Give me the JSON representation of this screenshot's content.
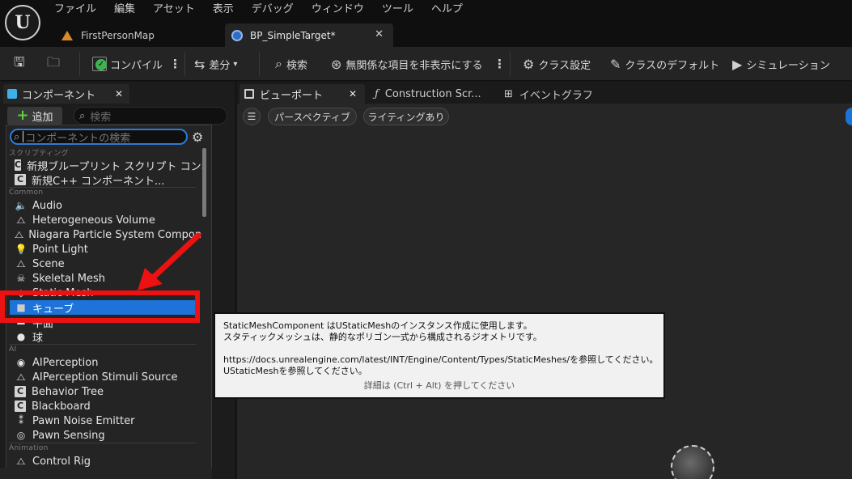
{
  "menu": [
    "ファイル",
    "編集",
    "アセット",
    "表示",
    "デバッグ",
    "ウィンドウ",
    "ツール",
    "ヘルプ"
  ],
  "doc_tabs": {
    "map": "FirstPersonMap",
    "blueprint": "BP_SimpleTarget*"
  },
  "toolbar": {
    "compile": "コンパイル",
    "diff": "差分",
    "search": "検索",
    "hide_unrelated": "無関係な項目を非表示にする",
    "class_settings": "クラス設定",
    "class_defaults": "クラスのデフォルト",
    "simulation": "シミュレーション"
  },
  "components_panel": {
    "tab_label": "コンポーネント",
    "add_label": "追加",
    "search_placeholder": "検索"
  },
  "dropdown": {
    "search_placeholder": "コンポーネントの検索",
    "categories": {
      "scripting": "スクリプティング",
      "common": "Common",
      "ai": "AI",
      "animation": "Animation"
    },
    "items": {
      "new_blueprint": "新規ブループリント スクリプト コンポーネント",
      "new_cpp": "新規C++ コンポーネント...",
      "audio": "Audio",
      "hetero_volume": "Heterogeneous Volume",
      "niagara": "Niagara Particle System Component",
      "point_light": "Point Light",
      "scene": "Scene",
      "skeletal_mesh": "Skeletal Mesh",
      "static_mesh": "Static Mesh",
      "cube": "キューブ",
      "plane": "平面",
      "sphere": "球",
      "ai_perception": "AIPerception",
      "ai_stimuli": "AIPerception Stimuli Source",
      "behavior_tree": "Behavior Tree",
      "blackboard": "Blackboard",
      "pawn_noise": "Pawn Noise Emitter",
      "pawn_sensing": "Pawn Sensing",
      "control_rig": "Control Rig"
    }
  },
  "viewport_tabs": {
    "viewport": "ビューポート",
    "construction": "Construction Scr...",
    "event_graph": "イベントグラフ"
  },
  "viewport": {
    "perspective": "パースペクティブ",
    "lighting": "ライティングあり"
  },
  "tooltip": {
    "line1": "StaticMeshComponent はUStaticMeshのインスタンス作成に使用します。",
    "line2": "スタティックメッシュは、静的なポリゴン一式から構成されるジオメトリです。",
    "line3": "https://docs.unrealengine.com/latest/INT/Engine/Content/Types/StaticMeshes/を参照してください。",
    "line4": "UStaticMeshを参照してください。",
    "hint": "詳細は (Ctrl + Alt) を押してください"
  },
  "colors": {
    "highlight": "#ee1111",
    "selection": "#1d73d8",
    "add_plus": "#5fcf3a"
  }
}
